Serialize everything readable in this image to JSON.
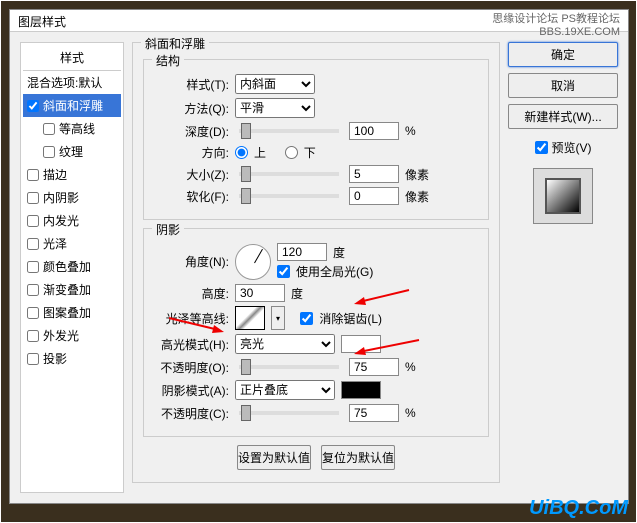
{
  "window": {
    "title": "图层样式"
  },
  "watermark": {
    "line1": "思缘设计论坛",
    "line2": "PS教程论坛",
    "line3": "BBS.19XE.COM"
  },
  "styles_panel": {
    "header": "样式",
    "blend_options": "混合选项:默认",
    "items": [
      {
        "label": "斜面和浮雕",
        "checked": true,
        "selected": true
      },
      {
        "label": "等高线",
        "checked": false,
        "indent": true
      },
      {
        "label": "纹理",
        "checked": false,
        "indent": true
      },
      {
        "label": "描边",
        "checked": false
      },
      {
        "label": "内阴影",
        "checked": false
      },
      {
        "label": "内发光",
        "checked": false
      },
      {
        "label": "光泽",
        "checked": false
      },
      {
        "label": "颜色叠加",
        "checked": false
      },
      {
        "label": "渐变叠加",
        "checked": false
      },
      {
        "label": "图案叠加",
        "checked": false
      },
      {
        "label": "外发光",
        "checked": false
      },
      {
        "label": "投影",
        "checked": false
      }
    ]
  },
  "bevel": {
    "section_title": "斜面和浮雕",
    "structure_title": "结构",
    "style_label": "样式(T):",
    "style_value": "内斜面",
    "technique_label": "方法(Q):",
    "technique_value": "平滑",
    "depth_label": "深度(D):",
    "depth_value": "100",
    "depth_unit": "%",
    "direction_label": "方向:",
    "direction_up": "上",
    "direction_down": "下",
    "direction_sel": "up",
    "size_label": "大小(Z):",
    "size_value": "5",
    "size_unit": "像素",
    "soften_label": "软化(F):",
    "soften_value": "0",
    "soften_unit": "像素"
  },
  "shading": {
    "title": "阴影",
    "angle_label": "角度(N):",
    "angle_value": "120",
    "angle_unit": "度",
    "global_light": "使用全局光(G)",
    "global_light_checked": true,
    "altitude_label": "高度:",
    "altitude_value": "30",
    "altitude_unit": "度",
    "gloss_contour_label": "光泽等高线:",
    "antialias": "消除锯齿(L)",
    "antialias_checked": true,
    "highlight_mode_label": "高光模式(H):",
    "highlight_mode_value": "亮光",
    "highlight_color": "#ffffff",
    "highlight_opacity_label": "不透明度(O):",
    "highlight_opacity_value": "75",
    "opacity_unit": "%",
    "shadow_mode_label": "阴影模式(A):",
    "shadow_mode_value": "正片叠底",
    "shadow_color": "#000000",
    "shadow_opacity_label": "不透明度(C):",
    "shadow_opacity_value": "75"
  },
  "buttons": {
    "ok": "确定",
    "cancel": "取消",
    "new_style": "新建样式(W)...",
    "preview": "预览(V)",
    "make_default": "设置为默认值",
    "reset_default": "复位为默认值"
  },
  "logo": "UiBQ.CoM"
}
